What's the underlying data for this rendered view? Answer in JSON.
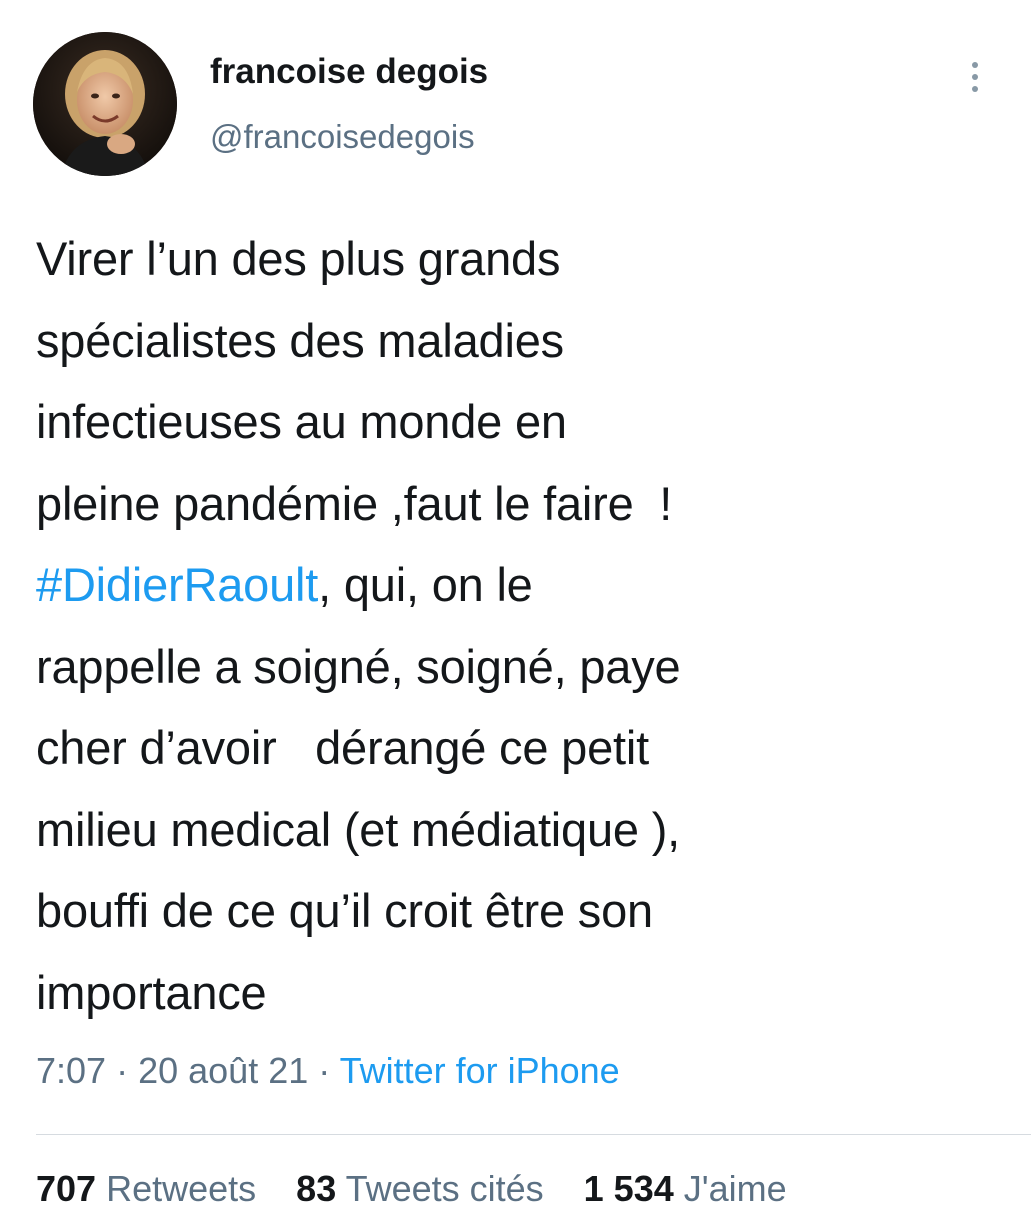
{
  "author": {
    "display_name": "francoise degois",
    "handle": "@francoisedegois",
    "avatar_icon": "profile-photo"
  },
  "more_icon": "more-vertical-icon",
  "tweet": {
    "lines": [
      {
        "text": "Virer l’un des plus grands"
      },
      {
        "text": "spécialistes des maladies"
      },
      {
        "text": "infectieuses au monde en"
      },
      {
        "text": "pleine pandémie ,faut le faire  !"
      },
      {
        "hashtag": "#DidierRaoult",
        "text": ", qui, on le"
      },
      {
        "text": "rappelle a soigné, soigné, paye"
      },
      {
        "text": "cher d’avoir   dérangé ce petit"
      },
      {
        "text": "milieu medical (et médiatique ),"
      },
      {
        "text": "bouffi de ce qu’il croit être son"
      },
      {
        "text": "importance"
      }
    ],
    "hashtag_color": "#1d9bf0"
  },
  "meta": {
    "time": "7:07",
    "separator": " · ",
    "date": "20 août 21",
    "source": "Twitter for iPhone"
  },
  "stats": {
    "retweets": {
      "count": "707",
      "label": " Retweets"
    },
    "quotes": {
      "count": "83",
      "label": " Tweets cités"
    },
    "likes": {
      "count": "1 534",
      "label": " J'aime"
    }
  },
  "colors": {
    "text": "#14171a",
    "secondary": "#5b7083",
    "link": "#1d9bf0"
  }
}
